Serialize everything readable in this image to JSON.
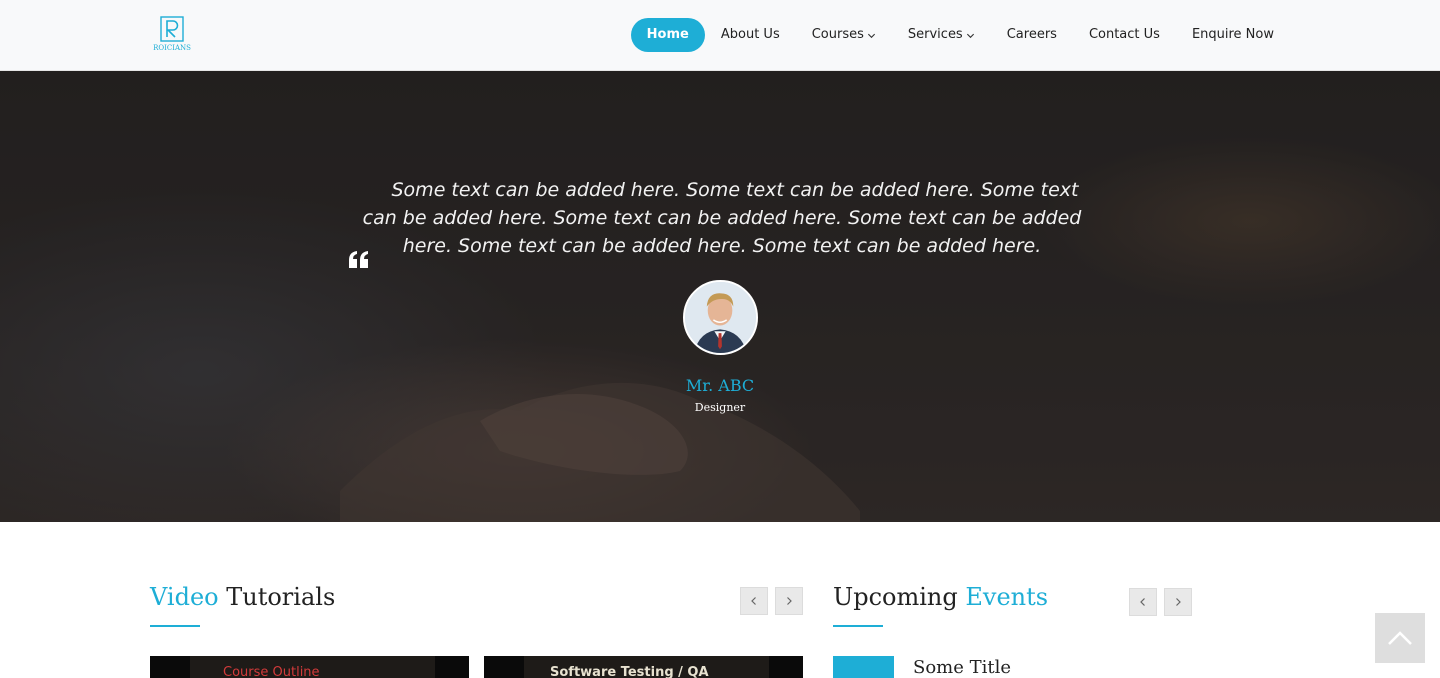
{
  "brand": {
    "logo_text": "ROICIANS"
  },
  "nav": {
    "items": [
      {
        "label": "Home",
        "active": true
      },
      {
        "label": "About Us"
      },
      {
        "label": "Courses",
        "dropdown": true
      },
      {
        "label": "Services",
        "dropdown": true
      },
      {
        "label": "Careers"
      },
      {
        "label": "Contact Us"
      },
      {
        "label": "Enquire Now"
      }
    ]
  },
  "testimonial": {
    "quote": "Some text can be added here. Some text can be added here. Some text can be added here. Some text can be added here. Some text can be added here. Some text can be added here. Some text can be added here.",
    "name": "Mr. ABC",
    "role": "Designer"
  },
  "video_section": {
    "title_accent": "Video",
    "title_rest": "Tutorials",
    "thumbnails": [
      {
        "caption": "Course Outline"
      },
      {
        "caption": "Software Testing / QA"
      }
    ]
  },
  "events_section": {
    "title_rest": "Upcoming",
    "title_accent": "Events",
    "first_event_title": "Some Title"
  },
  "colors": {
    "accent": "#1eaed6",
    "header_bg": "#f8f9fa"
  },
  "icons": {
    "quote": "quote-left-icon",
    "prev": "chevron-left-icon",
    "next": "chevron-right-icon",
    "scroll_top": "chevron-up-icon",
    "dropdown": "chevron-down-icon"
  }
}
